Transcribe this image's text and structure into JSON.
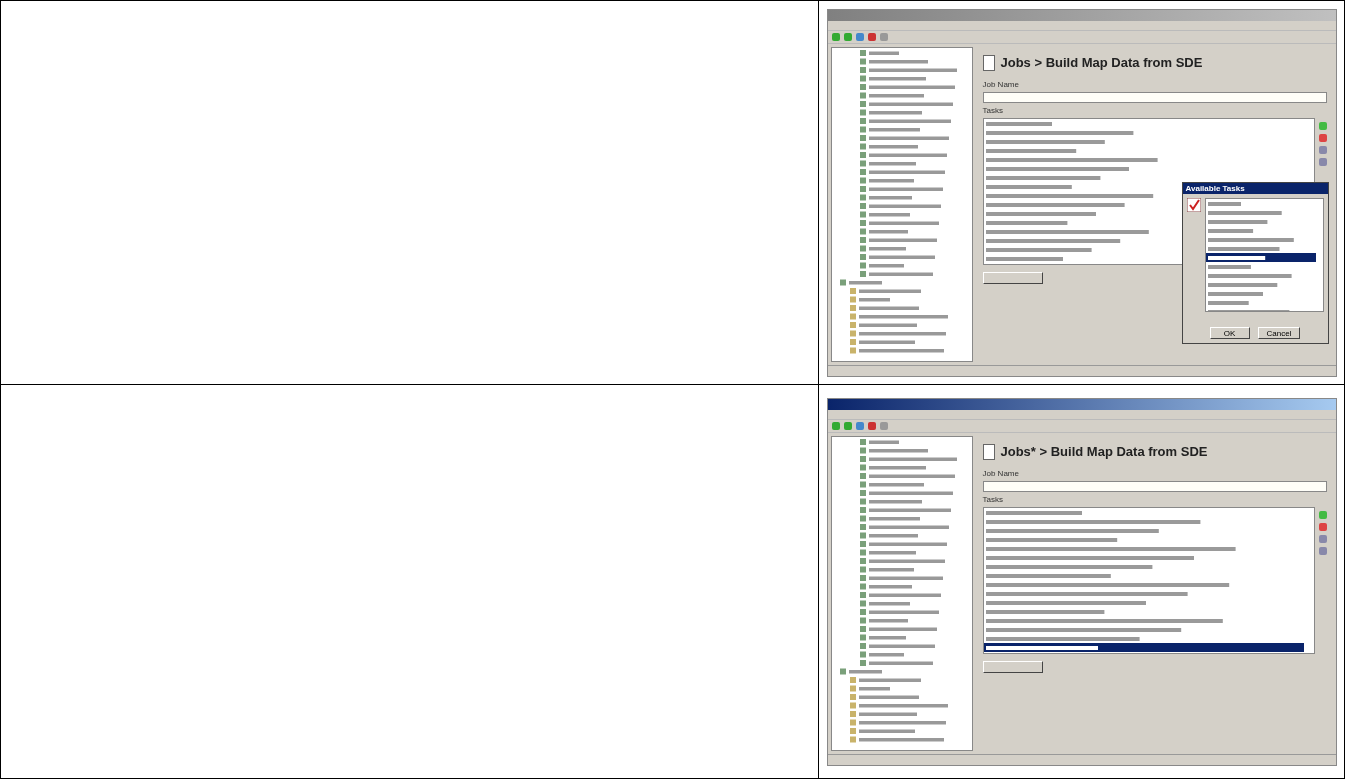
{
  "rows": [
    {
      "window": {
        "active": false,
        "heading": "Jobs > Build Map Data from SDE",
        "field_label": "Job Name",
        "list_label": "Tasks",
        "list_last_selected": false,
        "dialog": {
          "title": "Available Tasks",
          "buttons": [
            "OK",
            "Cancel"
          ]
        }
      }
    },
    {
      "window": {
        "active": true,
        "heading": "Jobs* > Build Map Data from SDE",
        "field_label": "Job Name",
        "list_label": "Tasks",
        "list_last_selected": true
      }
    }
  ]
}
